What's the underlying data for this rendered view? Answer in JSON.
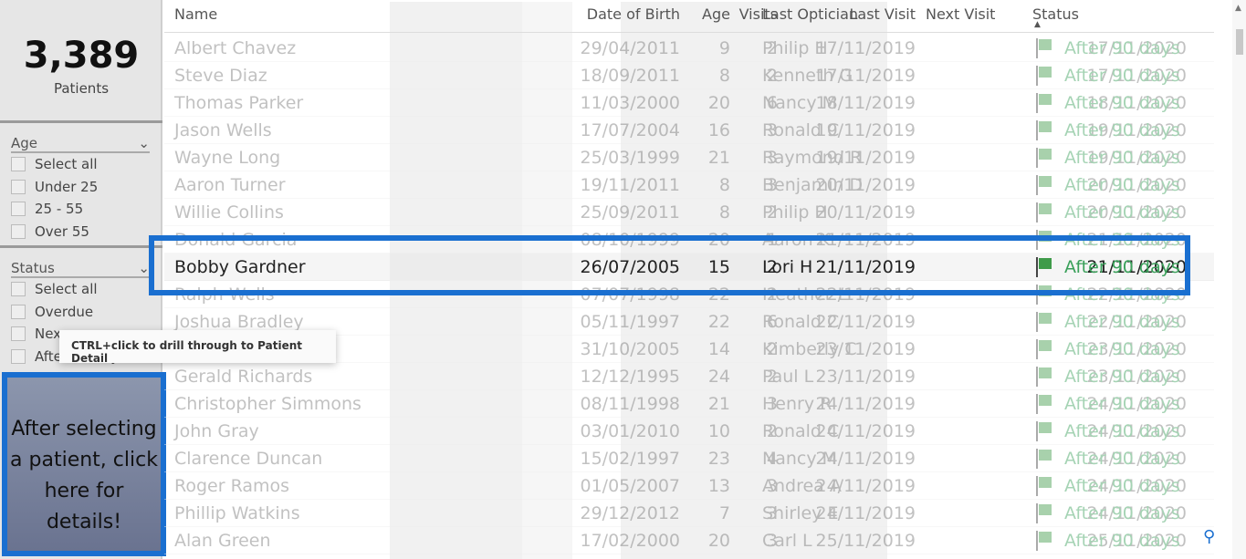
{
  "kpi": {
    "value": "3,389",
    "label": "Patients"
  },
  "age_slicer": {
    "title": "Age",
    "items": [
      "Select all",
      "Under 25",
      "25 - 55",
      "Over 55"
    ]
  },
  "status_slicer": {
    "title": "Status",
    "items": [
      "Select all",
      "Overdue",
      "Nex",
      "After 90 days"
    ]
  },
  "details_button": {
    "label": "After selecting a patient, click here for details!"
  },
  "tooltip": "CTRL+click to drill through to Patient Detail",
  "columns": [
    "Name",
    "Date of Birth",
    "Age",
    "Visits",
    "Last Visit",
    "Last Optician",
    "Next Visit",
    "Status"
  ],
  "selected_index": 8,
  "rows": [
    [
      "Albert Chavez",
      "29/04/2011",
      "9",
      "2",
      "17/11/2019",
      "Philip H",
      "17/11/2020",
      "After 90 days"
    ],
    [
      "Steve Diaz",
      "18/09/2011",
      "8",
      "2",
      "17/11/2019",
      "Kenneth G",
      "17/11/2020",
      "After 90 days"
    ],
    [
      "Thomas Parker",
      "11/03/2000",
      "20",
      "6",
      "18/11/2019",
      "Nancy M",
      "18/11/2020",
      "After 90 days"
    ],
    [
      "Jason Wells",
      "17/07/2004",
      "16",
      "3",
      "19/11/2019",
      "Ronald C",
      "19/11/2020",
      "After 90 days"
    ],
    [
      "Wayne Long",
      "25/03/1999",
      "21",
      "3",
      "19/11/2019",
      "Raymond R",
      "19/11/2020",
      "After 90 days"
    ],
    [
      "Aaron Turner",
      "19/11/2011",
      "8",
      "3",
      "20/11/2019",
      "Benjamin D",
      "20/11/2020",
      "After 90 days"
    ],
    [
      "Willie Collins",
      "25/09/2011",
      "8",
      "2",
      "20/11/2019",
      "Philip H",
      "20/11/2020",
      "After 90 days"
    ],
    [
      "Donald Garcia",
      "08/10/1999",
      "20",
      "1",
      "21/11/2019",
      "Aaron K",
      "21/11/2020",
      "After 90 days"
    ],
    [
      "Bobby Gardner",
      "26/07/2005",
      "15",
      "2",
      "21/11/2019",
      "Lori H",
      "21/11/2020",
      "After 90 days"
    ],
    [
      "Ralph Wells",
      "07/07/1998",
      "22",
      "2",
      "22/11/2019",
      "Heather L",
      "22/11/2020",
      "After 90 days"
    ],
    [
      "Joshua Bradley",
      "05/11/1997",
      "22",
      "6",
      "22/11/2019",
      "Ronald C",
      "22/11/2020",
      "After 90 days"
    ],
    [
      "",
      "31/10/2005",
      "14",
      "2",
      "23/11/2019",
      "Kimberly C",
      "23/11/2020",
      "After 90 days"
    ],
    [
      "Gerald Richards",
      "12/12/1995",
      "24",
      "2",
      "23/11/2019",
      "Paul L",
      "23/11/2020",
      "After 90 days"
    ],
    [
      "Christopher Simmons",
      "08/11/1998",
      "21",
      "3",
      "24/11/2019",
      "Henry R",
      "24/11/2020",
      "After 90 days"
    ],
    [
      "John Gray",
      "03/01/2010",
      "10",
      "2",
      "24/11/2019",
      "Ronald C",
      "24/11/2020",
      "After 90 days"
    ],
    [
      "Clarence Duncan",
      "15/02/1997",
      "23",
      "4",
      "24/11/2019",
      "Nancy M",
      "24/11/2020",
      "After 90 days"
    ],
    [
      "Roger Ramos",
      "01/05/2007",
      "13",
      "3",
      "24/11/2019",
      "Andrea A",
      "24/11/2020",
      "After 90 days"
    ],
    [
      "Phillip Watkins",
      "29/12/2012",
      "7",
      "3",
      "24/11/2019",
      "Shirley E",
      "24/11/2020",
      "After 90 days"
    ],
    [
      "Alan Green",
      "17/02/2000",
      "20",
      "3",
      "25/11/2019",
      "Carl L",
      "25/11/2020",
      "After 90 days"
    ]
  ]
}
